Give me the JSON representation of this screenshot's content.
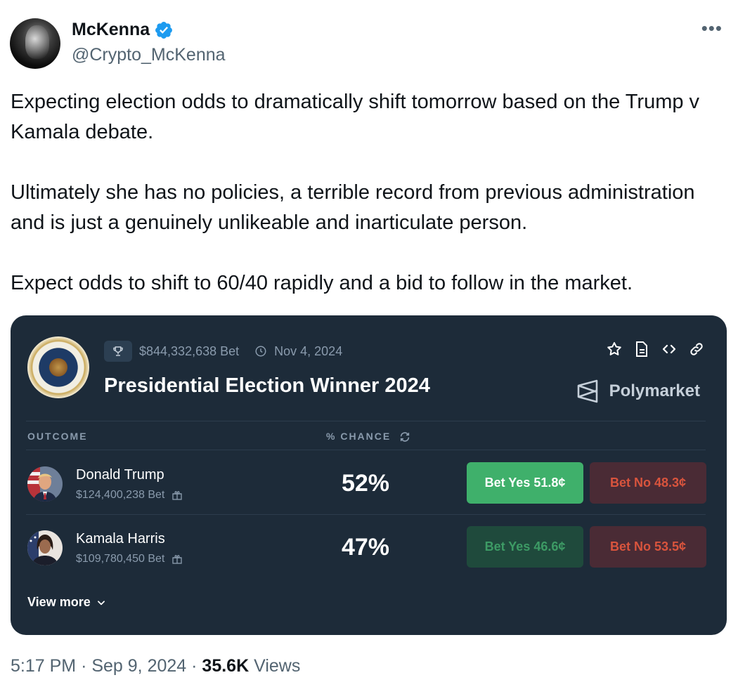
{
  "author": {
    "display_name": "McKenna",
    "handle": "@Crypto_McKenna",
    "verified_color": "#1d9bf0"
  },
  "tweet": {
    "paragraphs": [
      "Expecting election odds to dramatically shift tomorrow based on the Trump v Kamala debate.",
      "Ultimately she has no policies, a terrible record from previous administration and is just a genuinely unlikeable and inarticulate person.",
      "Expect odds to shift to 60/40 rapidly and a bid to follow in the market."
    ]
  },
  "card": {
    "bet_volume": "$844,332,638 Bet",
    "end_date": "Nov 4, 2024",
    "title": "Presidential Election Winner 2024",
    "brand": "Polymarket",
    "columns": {
      "outcome": "OUTCOME",
      "chance": "% CHANCE"
    },
    "outcomes": [
      {
        "name": "Donald Trump",
        "bet": "$124,400,238 Bet",
        "chance": "52%",
        "yes_label": "Bet Yes 51.8¢",
        "no_label": "Bet No 48.3¢"
      },
      {
        "name": "Kamala Harris",
        "bet": "$109,780,450 Bet",
        "chance": "47%",
        "yes_label": "Bet Yes 46.6¢",
        "no_label": "Bet No 53.5¢"
      }
    ],
    "view_more": "View more",
    "colors": {
      "background": "#1d2b39",
      "yes_active": "#3fb06b",
      "no": "#d9543d"
    }
  },
  "footer": {
    "time": "5:17 PM",
    "date": "Sep 9, 2024",
    "views_count": "35.6K",
    "views_label": "Views"
  }
}
